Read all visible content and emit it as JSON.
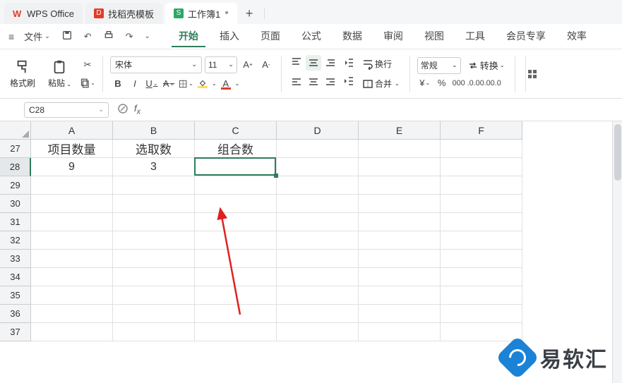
{
  "tabs": [
    {
      "label": "WPS Office",
      "icon": "W"
    },
    {
      "label": "找稻壳模板",
      "icon": "D"
    },
    {
      "label": "工作簿1",
      "icon": "S"
    }
  ],
  "menu": {
    "file": "文件",
    "items": [
      "开始",
      "插入",
      "页面",
      "公式",
      "数据",
      "审阅",
      "视图",
      "工具",
      "会员专享",
      "效率"
    ],
    "active": 0
  },
  "ribbon": {
    "format_painter": "格式刷",
    "paste": "粘贴",
    "font_name": "宋体",
    "font_size": "11",
    "wrap_text": "换行",
    "merge": "合并",
    "number_format": "常规",
    "convert": "转换"
  },
  "name_box": "C28",
  "formula": "",
  "columns": [
    "A",
    "B",
    "C",
    "D",
    "E",
    "F"
  ],
  "rows": [
    "27",
    "28",
    "29",
    "30",
    "31",
    "32",
    "33",
    "34",
    "35",
    "36",
    "37"
  ],
  "selected_row_idx": 1,
  "cells": {
    "A27": "项目数量",
    "B27": "选取数",
    "C27": "组合数",
    "A28": "9",
    "B28": "3"
  },
  "selection": {
    "col": 2,
    "row": 1
  },
  "watermark": "易软汇"
}
